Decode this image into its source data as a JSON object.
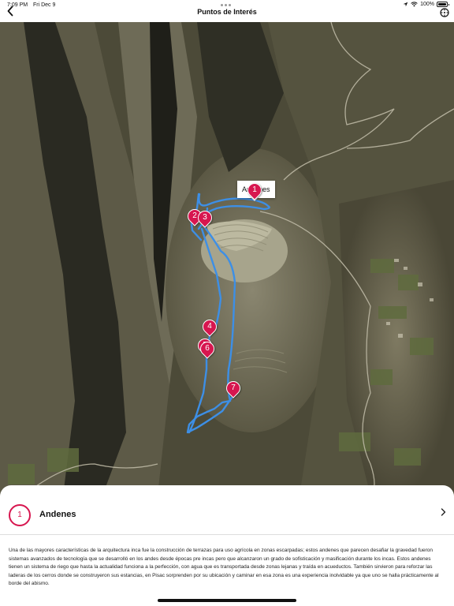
{
  "status_bar": {
    "time": "7:09 PM",
    "date": "Fri Dec 9",
    "battery": "100%",
    "battery_level": 1.0
  },
  "nav": {
    "title": "Puntos de Interés",
    "back_icon": "chevron-left-icon",
    "right_icon": "compass-icon"
  },
  "map": {
    "callout": "Andenes",
    "route_color": "#3d8fe6",
    "pin_color": "#d7164f",
    "pins": [
      {
        "label": "1"
      },
      {
        "label": "2"
      },
      {
        "label": "3"
      },
      {
        "label": "4"
      },
      {
        "label": "5"
      },
      {
        "label": "6"
      },
      {
        "label": "7"
      }
    ]
  },
  "sheet": {
    "number": "1",
    "title": "Andenes",
    "chevron_icon": "chevron-right-icon",
    "description": "Una de las mayores características de la arquitectura inca fue la construcción de terrazas para uso agrícola en zonas escarpadas; estos andenes que parecen desafiar la gravedad fueron sistemas avanzados de tecnología que se desarrolló en los andes desde épocas pre incas pero que alcanzaron un grado de sofisticación y masificación durante los incas. Estos andenes tienen un sistema de riego que hasta la actualidad funciona a la perfección, con agua que es transportada desde zonas lejanas y traída en acueductos. También sirvieron para reforzar las laderas de los cerros donde se construyeron sus estancias, en Pisac sorprenden por su ubicación y caminar en esa zona es una experiencia inolvidable ya que uno se halla prácticamente al borde del abismo."
  }
}
